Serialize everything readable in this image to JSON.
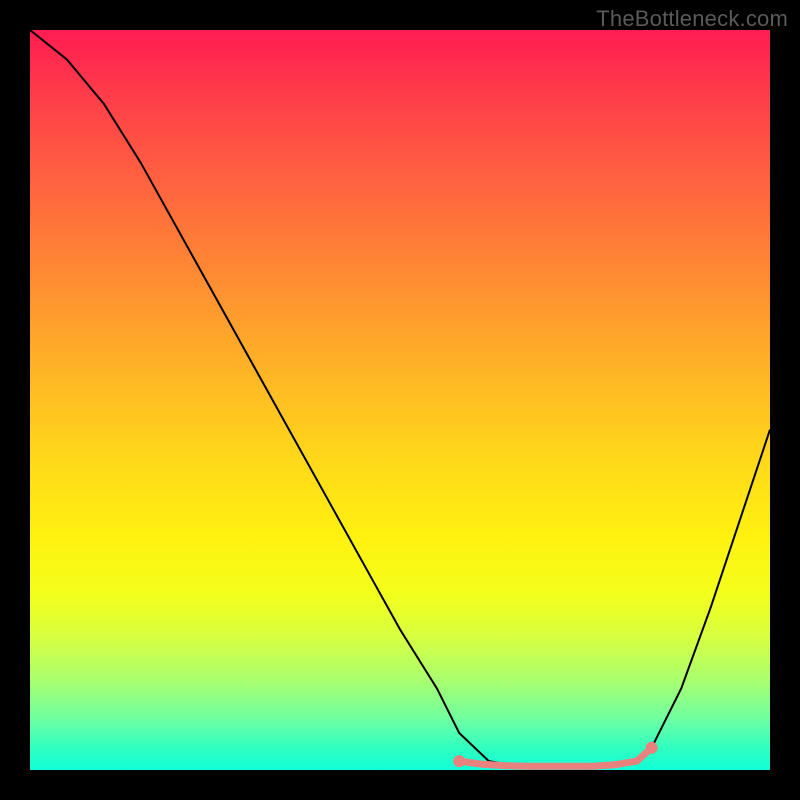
{
  "watermark": "TheBottleneck.com",
  "chart_data": {
    "type": "line",
    "title": "",
    "xlabel": "",
    "ylabel": "",
    "xlim": [
      0,
      100
    ],
    "ylim": [
      0,
      100
    ],
    "grid": false,
    "series": [
      {
        "name": "curve",
        "color": "#000000",
        "x": [
          0,
          5,
          10,
          15,
          20,
          25,
          30,
          35,
          40,
          45,
          50,
          55,
          58,
          62,
          66,
          70,
          74,
          78,
          82,
          84,
          88,
          92,
          96,
          100
        ],
        "y": [
          100,
          96,
          90,
          82,
          73,
          64,
          55,
          46,
          37,
          28,
          19,
          11,
          5,
          1.2,
          0.5,
          0.5,
          0.5,
          0.5,
          1.2,
          3,
          11,
          22,
          34,
          46
        ]
      },
      {
        "name": "flat-region-markers",
        "color": "#e9817e",
        "x": [
          58,
          61,
          64,
          67,
          70,
          73,
          76,
          79,
          82,
          84
        ],
        "y": [
          1.2,
          0.8,
          0.6,
          0.5,
          0.5,
          0.5,
          0.5,
          0.7,
          1.2,
          3
        ]
      }
    ]
  },
  "colors": {
    "frame": "#000000",
    "watermark": "#5a5a5a",
    "marker": "#e9817e",
    "gradient_top": "#ff1c52",
    "gradient_bottom": "#10ffd8"
  }
}
